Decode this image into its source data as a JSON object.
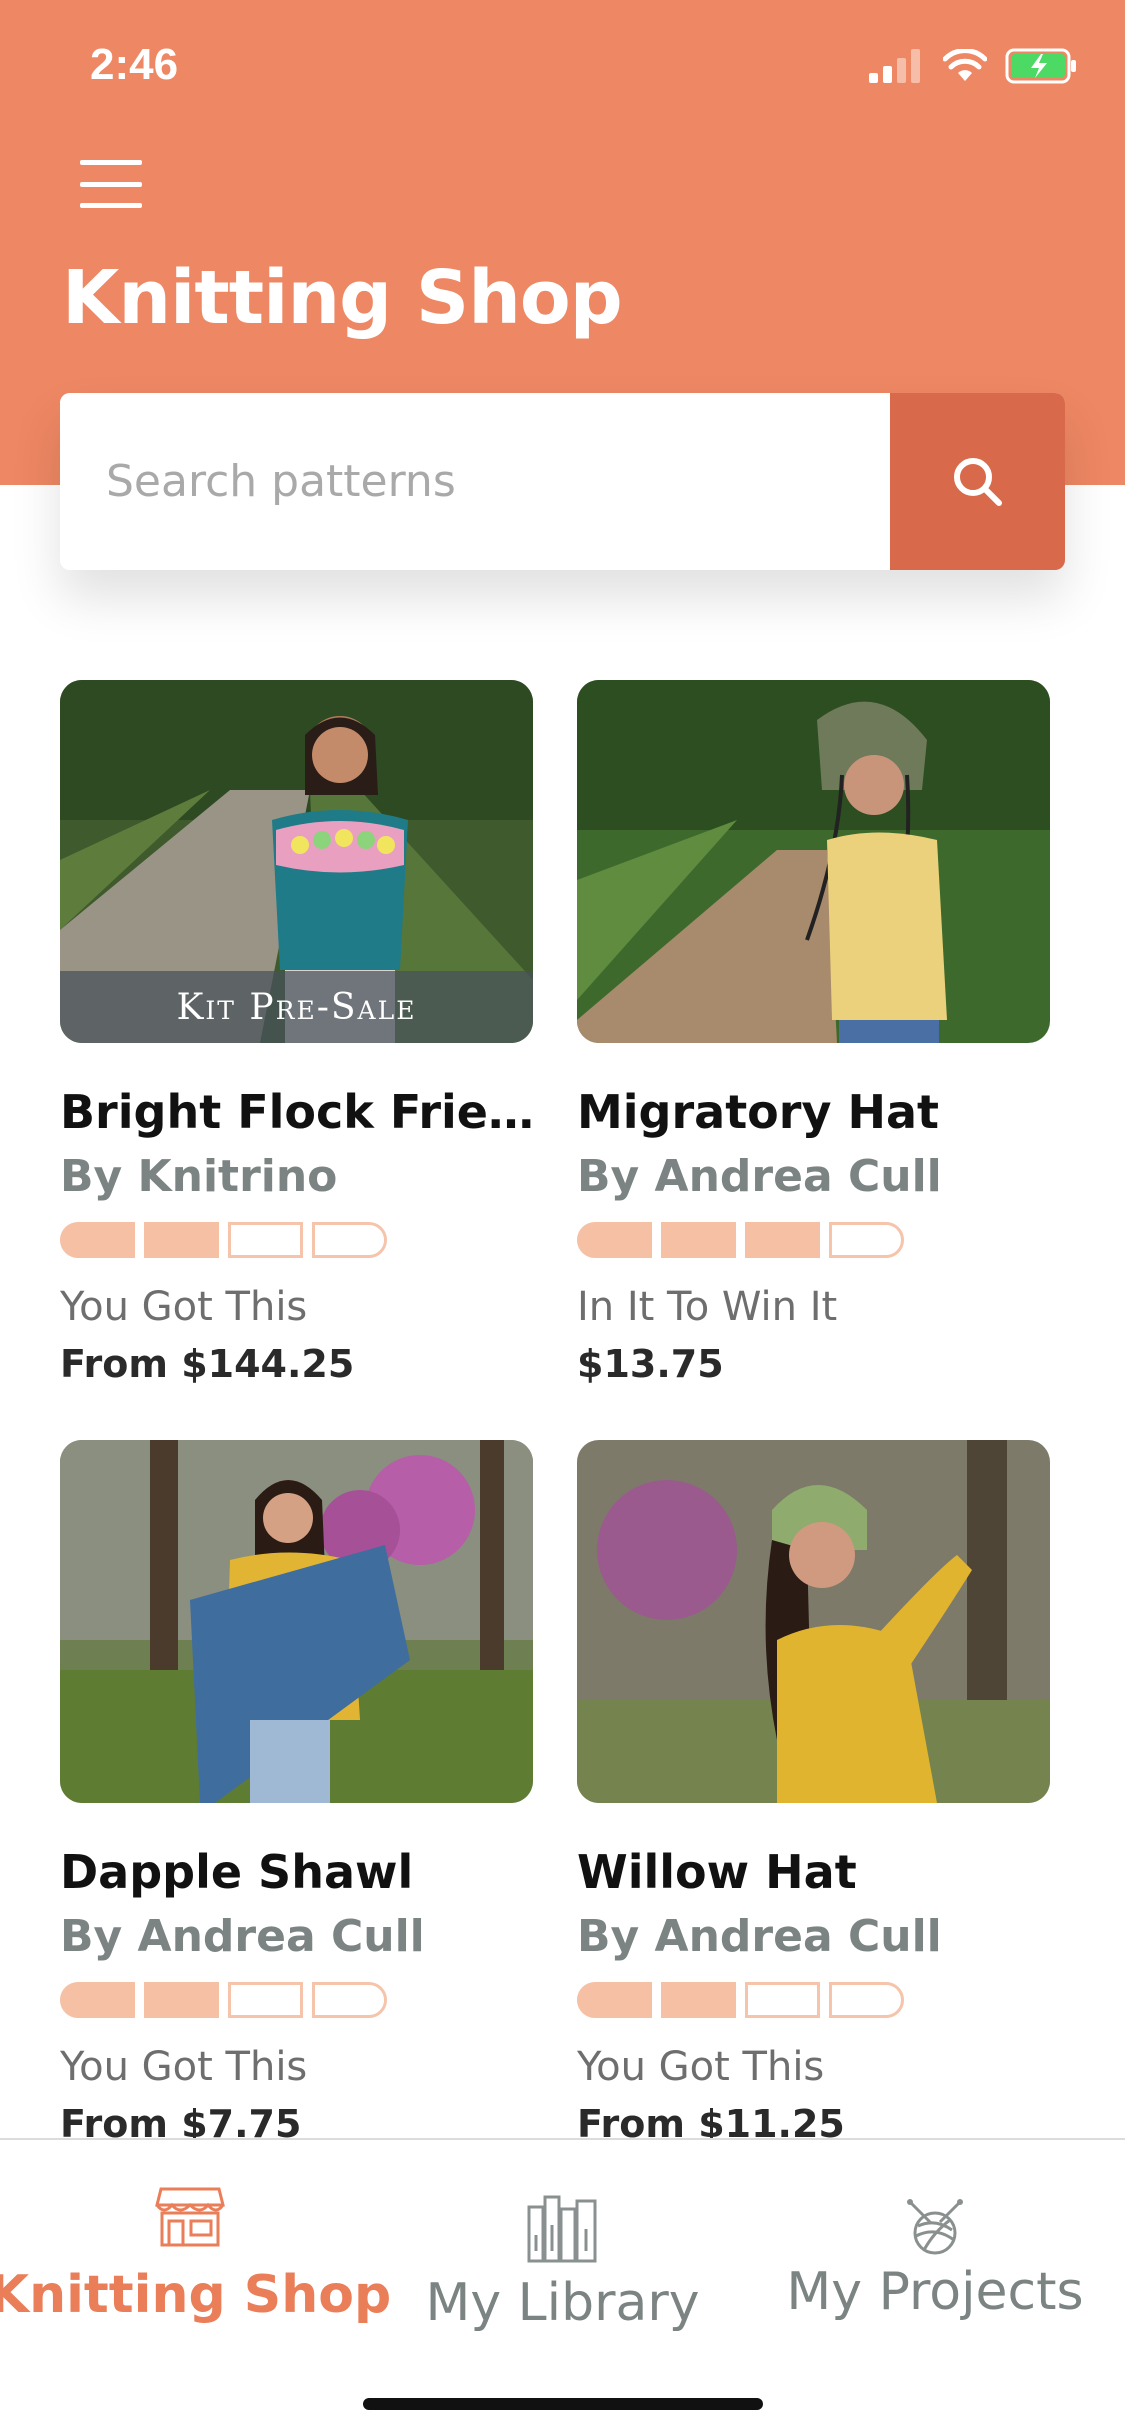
{
  "status_bar": {
    "time": "2:46"
  },
  "header": {
    "title": "Knitting Shop"
  },
  "search": {
    "placeholder": "Search patterns",
    "value": ""
  },
  "colors": {
    "accent": "#ee8763",
    "search_button": "#d8694a",
    "difficulty_fill": "#f6c0a5",
    "author": "#7b8383"
  },
  "products": [
    {
      "title": "Bright Flock Friend…",
      "author": "By Knitrino",
      "difficulty": 2,
      "difficulty_max": 4,
      "level": "You Got This",
      "price": "From $144.25",
      "badge": "Kit Pre-Sale"
    },
    {
      "title": "Migratory Hat",
      "author": "By Andrea Cull",
      "difficulty": 3,
      "difficulty_max": 4,
      "level": "In It To Win It",
      "price": "$13.75"
    },
    {
      "title": "Dapple Shawl",
      "author": "By Andrea Cull",
      "difficulty": 2,
      "difficulty_max": 4,
      "level": "You Got This",
      "price": "From $7.75"
    },
    {
      "title": "Willow Hat",
      "author": "By Andrea Cull",
      "difficulty": 2,
      "difficulty_max": 4,
      "level": "You Got This",
      "price": "From $11.25"
    }
  ],
  "tabs": [
    {
      "label": "Knitting Shop",
      "icon": "storefront-icon",
      "active": true
    },
    {
      "label": "My Library",
      "icon": "bookshelf-icon",
      "active": false
    },
    {
      "label": "My Projects",
      "icon": "yarn-ball-icon",
      "active": false
    }
  ]
}
